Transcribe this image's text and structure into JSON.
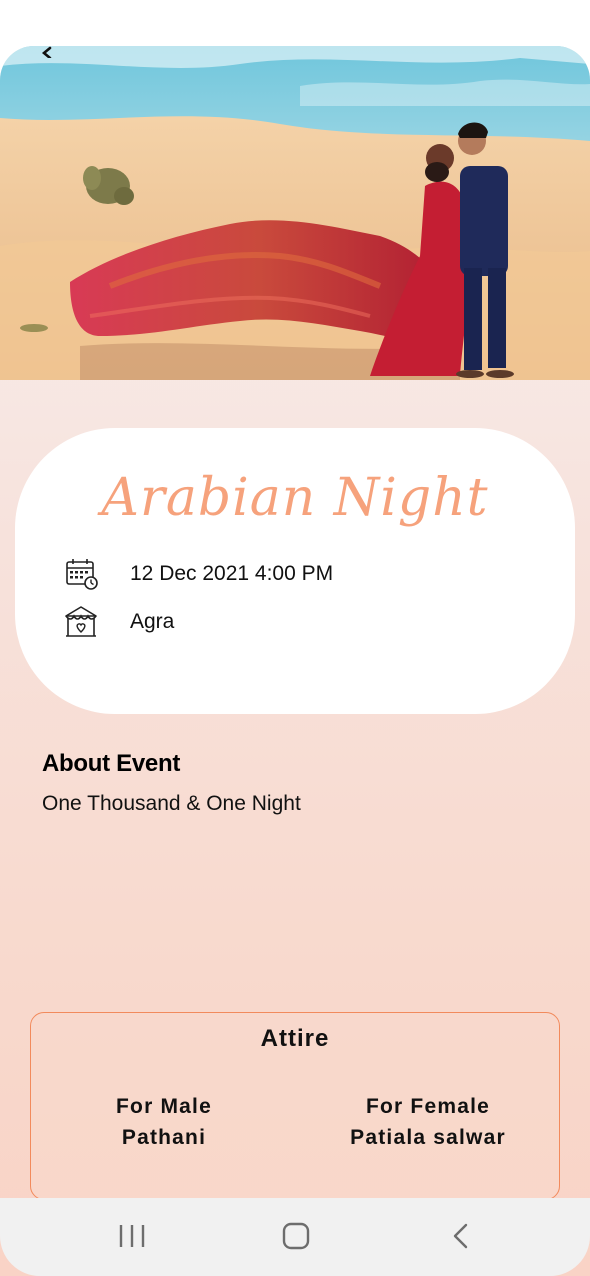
{
  "event": {
    "title": "Arabian Night",
    "date_time": "12 Dec 2021 4:00 PM",
    "location": "Agra",
    "date_icon": "calendar-clock-icon",
    "location_icon": "venue-tent-icon"
  },
  "about": {
    "heading": "About Event",
    "text": "One Thousand & One Night"
  },
  "attire": {
    "title": "Attire",
    "male_label": "For Male",
    "male_value": "Pathani",
    "female_label": "For Female",
    "female_value": "Patiala salwar"
  },
  "nav": {
    "recents_icon": "recents-icon",
    "home_icon": "home-icon",
    "back_icon": "back-chevron-icon"
  },
  "colors": {
    "title_accent": "#f6a27c",
    "attire_border": "#f28a5c"
  }
}
